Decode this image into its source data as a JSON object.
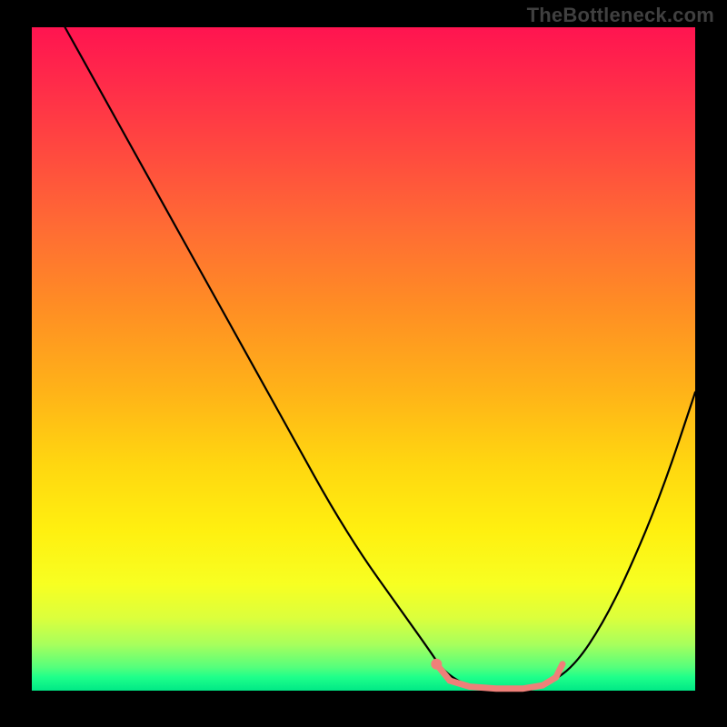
{
  "watermark": "TheBottleneck.com",
  "chart_data": {
    "type": "line",
    "title": "",
    "xlabel": "",
    "ylabel": "",
    "xlim": [
      0,
      100
    ],
    "ylim": [
      0,
      100
    ],
    "grid": false,
    "legend": false,
    "background_gradient": {
      "orientation": "vertical",
      "stops": [
        {
          "pos": 0.0,
          "color": "#ff1450"
        },
        {
          "pos": 0.3,
          "color": "#ff6b34"
        },
        {
          "pos": 0.55,
          "color": "#ffb318"
        },
        {
          "pos": 0.76,
          "color": "#fff010"
        },
        {
          "pos": 0.93,
          "color": "#a8ff5c"
        },
        {
          "pos": 1.0,
          "color": "#00e886"
        }
      ]
    },
    "series": [
      {
        "name": "bottleneck-curve",
        "color": "#000000",
        "x": [
          5,
          10,
          15,
          20,
          25,
          30,
          35,
          40,
          45,
          50,
          55,
          60,
          62,
          65,
          68,
          72,
          75,
          78,
          82,
          86,
          90,
          95,
          100
        ],
        "y": [
          100,
          91,
          82,
          73,
          64,
          55,
          46,
          37,
          28,
          20,
          13,
          6,
          3,
          1,
          0,
          0,
          0,
          1,
          4,
          10,
          18,
          30,
          45
        ]
      }
    ],
    "marker": {
      "name": "optimal-range",
      "color": "#ef8079",
      "start_dot": {
        "x": 61,
        "y": 4
      },
      "path": {
        "x": [
          61,
          63,
          66,
          70,
          74,
          77,
          79,
          80
        ],
        "y": [
          4,
          1.5,
          0.6,
          0.3,
          0.3,
          0.8,
          2,
          4
        ]
      }
    }
  }
}
